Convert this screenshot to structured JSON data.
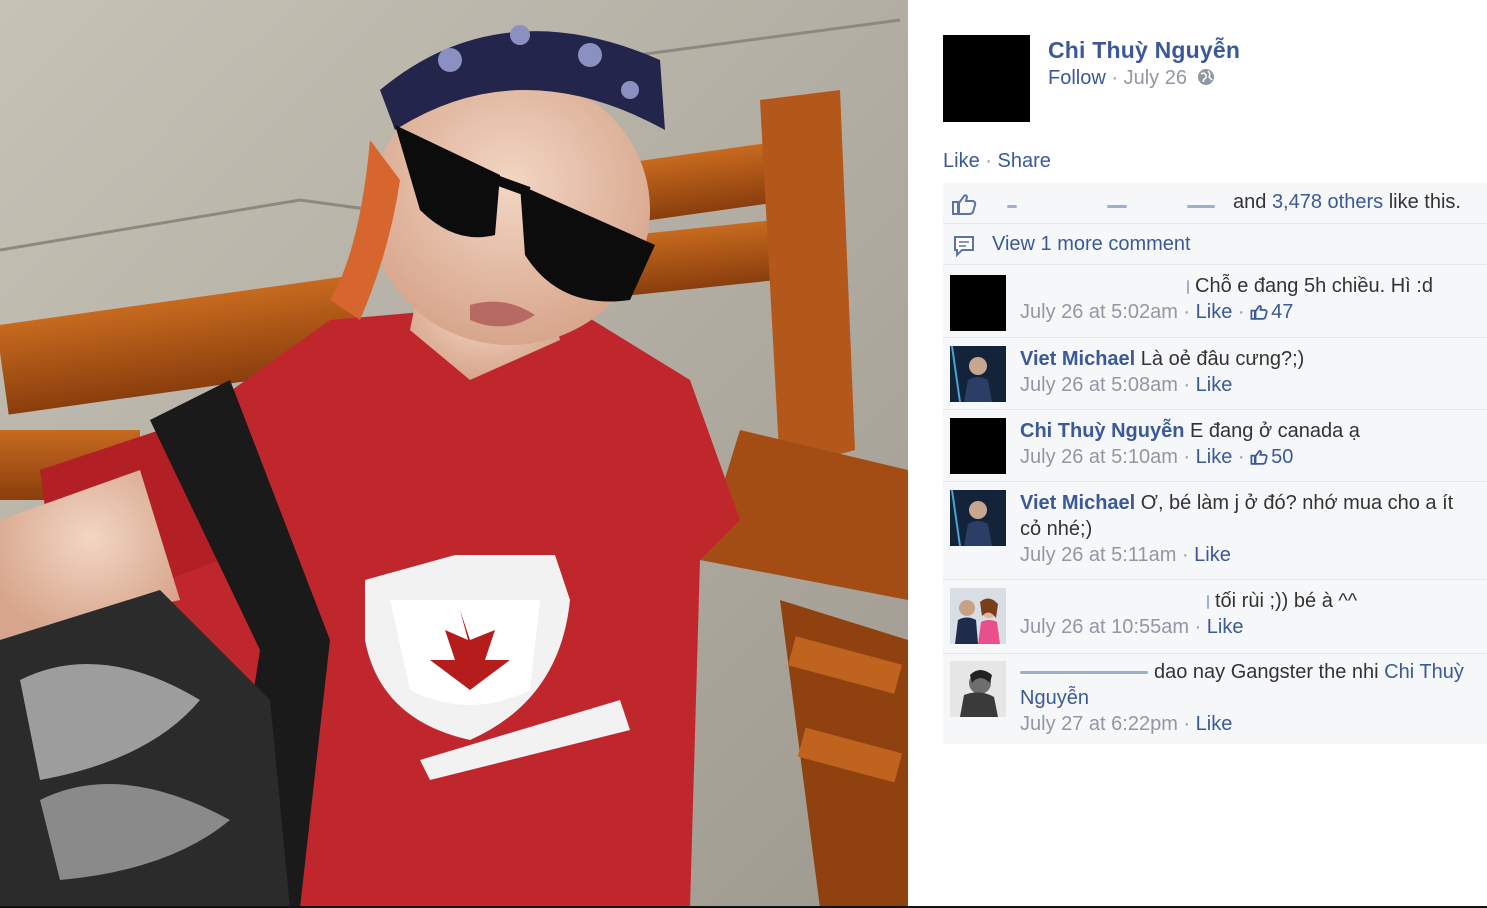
{
  "post": {
    "author": "Chi Thuỳ Nguyễn",
    "follow": "Follow",
    "dot": "·",
    "date": "July 26",
    "like_action": "Like",
    "share_action": "Share"
  },
  "likes": {
    "and": "and",
    "count_link": "3,478 others",
    "suffix": "like this."
  },
  "view_more": "View 1 more comment",
  "comments": [
    {
      "name": "",
      "text": "Chỗ e đang 5h chiều. Hì :d",
      "time": "July 26 at 5:02am",
      "like": "Like",
      "likes": "47"
    },
    {
      "name": "Viet Michael",
      "text": "Là oẻ đâu cưng?;)",
      "time": "July 26 at 5:08am",
      "like": "Like"
    },
    {
      "name": "Chi Thuỳ Nguyễn",
      "text": "E đang ở canada ạ",
      "time": "July 26 at 5:10am",
      "like": "Like",
      "likes": "50"
    },
    {
      "name": "Viet Michael",
      "text": "Ơ, bé làm j ở đó? nhớ mua cho a ít cỏ nhé;)",
      "time": "July 26 at 5:11am",
      "like": "Like"
    },
    {
      "name": "",
      "text": "tối rùi ;)) bé à ^^",
      "time": "July 26 at 10:55am",
      "like": "Like"
    },
    {
      "name": "",
      "text": "dao nay Gangster the nhi",
      "mention": "Chi Thuỳ Nguyễn",
      "time": "July 27 at 6:22pm",
      "like": "Like"
    }
  ],
  "icons": {
    "globe": "globe-icon",
    "thumb": "thumbs-up-icon",
    "bubble": "comment-bubble-icon"
  },
  "colors": {
    "link": "#3b5998",
    "meta": "#9197a3",
    "ufi_bg": "#f6f7f9"
  }
}
